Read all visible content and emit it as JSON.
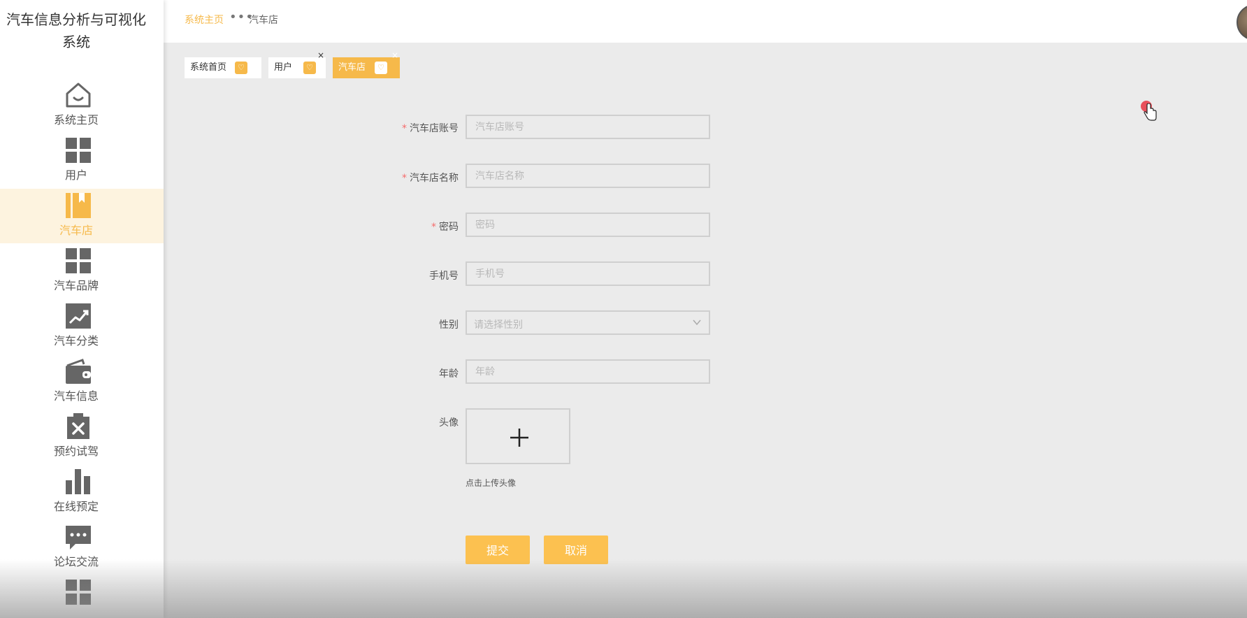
{
  "app": {
    "title": "汽车信息分析与可视化系统"
  },
  "sidebar": {
    "items": [
      {
        "label": "系统主页",
        "icon": "home-icon",
        "active": false
      },
      {
        "label": "用户",
        "icon": "grid-icon",
        "active": false
      },
      {
        "label": "汽车店",
        "icon": "bookmark-icon",
        "active": true
      },
      {
        "label": "汽车品牌",
        "icon": "grid-icon",
        "active": false
      },
      {
        "label": "汽车分类",
        "icon": "trend-chart-icon",
        "active": false
      },
      {
        "label": "汽车信息",
        "icon": "wallet-icon",
        "active": false
      },
      {
        "label": "预约试驾",
        "icon": "delete-clipboard-icon",
        "active": false
      },
      {
        "label": "在线预定",
        "icon": "bar-chart-icon",
        "active": false
      },
      {
        "label": "论坛交流",
        "icon": "chat-icon",
        "active": false
      },
      {
        "label": "",
        "icon": "grid-icon",
        "active": false
      }
    ]
  },
  "header": {
    "breadcrumb": {
      "home": "系统主页",
      "separator": "•••",
      "current": "汽车店"
    },
    "avatar_icon": "user-avatar"
  },
  "tabs": [
    {
      "label": "系统首页",
      "fav": "♡",
      "close": "",
      "active": false
    },
    {
      "label": "用户",
      "fav": "♡",
      "close": "×",
      "active": false
    },
    {
      "label": "汽车店",
      "fav": "♡",
      "close": "×",
      "active": true
    }
  ],
  "form": {
    "account": {
      "label": "汽车店账号",
      "required": "*",
      "placeholder": "汽车店账号"
    },
    "name": {
      "label": "汽车店名称",
      "required": "*",
      "placeholder": "汽车店名称"
    },
    "password": {
      "label": "密码",
      "required": "*",
      "placeholder": "密码"
    },
    "phone": {
      "label": "手机号",
      "placeholder": "手机号"
    },
    "gender": {
      "label": "性别",
      "placeholder": "请选择性别"
    },
    "age": {
      "label": "年龄",
      "placeholder": "年龄"
    },
    "avatar": {
      "label": "头像",
      "tip": "点击上传头像"
    },
    "submit_label": "提交",
    "cancel_label": "取消"
  },
  "colors": {
    "accent": "#f6b94a",
    "button": "#fcc150",
    "active_nav_bg": "#fdf3df",
    "required": "#f56c6c",
    "page_bg": "#ebebeb"
  }
}
